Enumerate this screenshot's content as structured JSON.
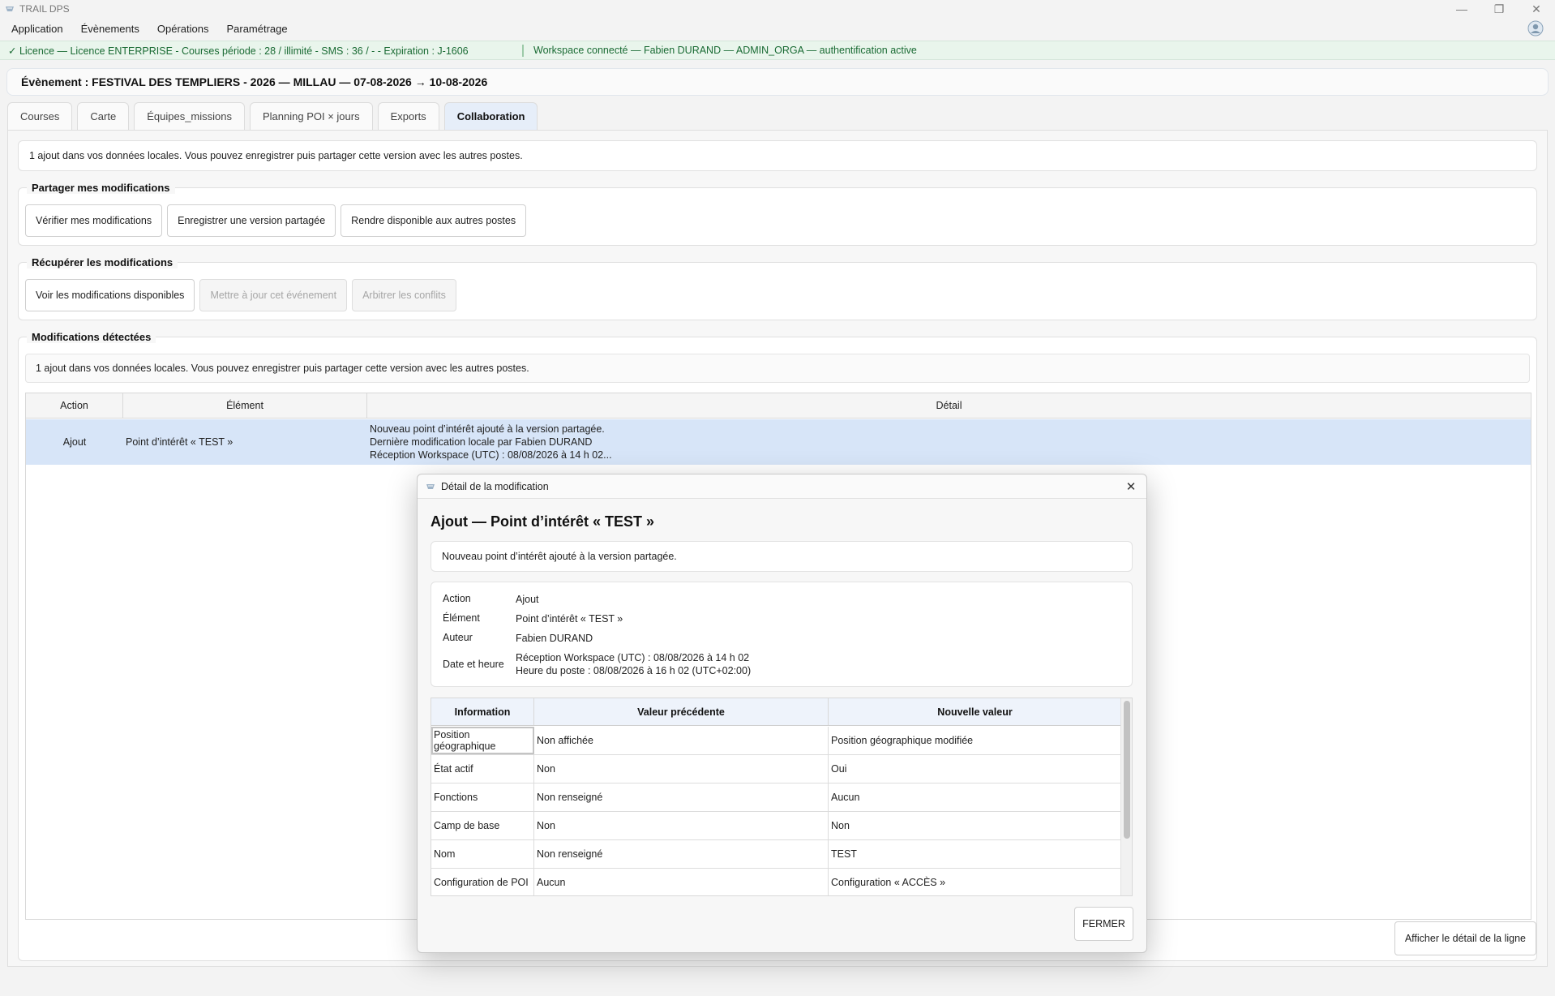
{
  "window": {
    "title": "TRAIL DPS",
    "minimize": "—",
    "maximize": "❐",
    "close": "✕"
  },
  "menu": [
    "Application",
    "Évènements",
    "Opérations",
    "Paramétrage"
  ],
  "licence": {
    "text": "✓ Licence — Licence ENTERPRISE - Courses période : 28 / illimité - SMS : 36 / - - Expiration : J-1606",
    "workspace": "Workspace connecté — Fabien DURAND — ADMIN_ORGA — authentification active"
  },
  "event": {
    "title": "Évènement : FESTIVAL DES TEMPLIERS - 2026 — MILLAU — 07-08-2026 → 10-08-2026"
  },
  "tabs": [
    "Courses",
    "Carte",
    "Équipes_missions",
    "Planning POI × jours",
    "Exports",
    "Collaboration"
  ],
  "active_tab": "Collaboration",
  "collab": {
    "info": "1 ajout dans vos données locales. Vous pouvez enregistrer puis partager cette version avec les autres postes.",
    "share": {
      "title": "Partager mes modifications",
      "buttons": [
        "Vérifier mes modifications",
        "Enregistrer une version partagée",
        "Rendre disponible aux autres postes"
      ]
    },
    "fetch": {
      "title": "Récupérer les modifications",
      "buttons": [
        "Voir les modifications disponibles",
        "Mettre à jour cet événement",
        "Arbitrer les conflits"
      ]
    },
    "detected": {
      "title": "Modifications détectées",
      "info": "1 ajout dans vos données locales. Vous pouvez enregistrer puis partager cette version avec les autres postes.",
      "columns": [
        "Action",
        "Élément",
        "Détail"
      ],
      "rows": [
        {
          "action": "Ajout",
          "element": "Point d’intérêt « TEST »",
          "detail": [
            "Nouveau point d’intérêt ajouté à la version partagée.",
            "Dernière modification locale par Fabien DURAND",
            "Réception Workspace (UTC) : 08/08/2026 à 14 h 02..."
          ]
        }
      ]
    },
    "show_detail_button": "Afficher le détail de la ligne"
  },
  "modal": {
    "window_title": "Détail de la modification",
    "heading": "Ajout — Point d’intérêt « TEST »",
    "summary": "Nouveau point d’intérêt ajouté à la version partagée.",
    "meta": {
      "action_label": "Action",
      "action_value": "Ajout",
      "element_label": "Élément",
      "element_value": "Point d’intérêt « TEST »",
      "author_label": "Auteur",
      "author_value": "Fabien DURAND",
      "datetime_label": "Date et heure",
      "datetime_line1": "Réception Workspace (UTC) : 08/08/2026 à 14 h 02",
      "datetime_line2": "Heure du poste : 08/08/2026 à 16 h 02 (UTC+02:00)"
    },
    "table": {
      "columns": [
        "Information",
        "Valeur précédente",
        "Nouvelle valeur"
      ],
      "rows": [
        [
          "Position géographique",
          "Non affichée",
          "Position géographique modifiée"
        ],
        [
          "État actif",
          "Non",
          "Oui"
        ],
        [
          "Fonctions",
          "Non renseigné",
          "Aucun"
        ],
        [
          "Camp de base",
          "Non",
          "Non"
        ],
        [
          "Nom",
          "Non renseigné",
          "TEST"
        ],
        [
          "Configuration de POI",
          "Aucun",
          "Configuration « ACCÈS »"
        ]
      ]
    },
    "close_button": "FERMER"
  }
}
